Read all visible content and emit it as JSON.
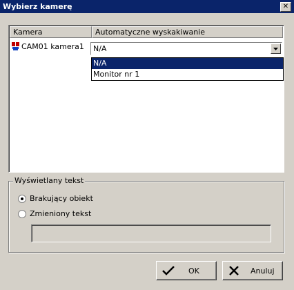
{
  "window": {
    "title": "Wybierz kamerę"
  },
  "table": {
    "headers": [
      "Kamera",
      "Automatyczne wyskakiwanie"
    ],
    "rows": [
      {
        "camera": "CAM01 kamera1",
        "auto_popup": "N/A"
      }
    ]
  },
  "dropdown": {
    "options": [
      "N/A",
      "Monitor nr 1"
    ],
    "selected": "N/A"
  },
  "display_text_group": {
    "label": "Wyświetlany tekst",
    "options": [
      {
        "label": "Brakujący obiekt",
        "checked": true
      },
      {
        "label": "Zmieniony tekst",
        "checked": false
      }
    ],
    "custom_text": ""
  },
  "buttons": {
    "ok": "OK",
    "cancel": "Anuluj"
  },
  "colors": {
    "titlebar": "#0a246a",
    "face": "#d4d0c8",
    "selection": "#0a246a"
  },
  "icons": {
    "camera": "camera-icon",
    "ok": "checkmark-icon",
    "cancel": "x-icon",
    "close": "close-icon"
  }
}
